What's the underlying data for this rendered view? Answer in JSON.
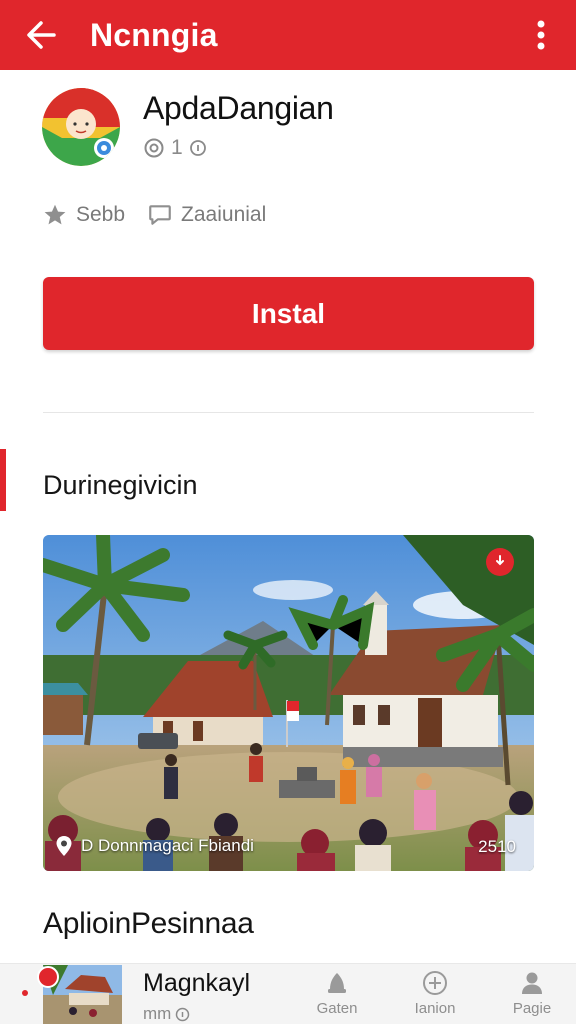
{
  "header": {
    "title": "Ncnngia",
    "back_icon": "arrow-left-icon",
    "menu_icon": "more-vertical-icon",
    "color": "#e0262c"
  },
  "app": {
    "name": "ApdaDangian",
    "meta_icon": "at-sign-icon",
    "meta_value": "1",
    "meta_tail_icon": "info-icon",
    "stats": [
      {
        "icon": "star-icon",
        "label": "Sebb"
      },
      {
        "icon": "comment-icon",
        "label": "Zaaiunial"
      }
    ]
  },
  "install": {
    "label": "Instal"
  },
  "section1": {
    "title": "Durinegivicin"
  },
  "photo": {
    "caption": "D Donnmagaci Fbiandi",
    "counter": "2510",
    "location_icon": "location-pin-icon",
    "badge_icon": "pin-badge-icon"
  },
  "section2": {
    "title": "AplioinPesinnaa"
  },
  "bottom": {
    "mini_title": "Magnkayl",
    "mini_sub": "mm",
    "nav": [
      {
        "icon": "home-icon",
        "label": "Gaten"
      },
      {
        "icon": "add-circle-icon",
        "label": "Ianion"
      },
      {
        "icon": "person-icon",
        "label": "Pagie"
      }
    ]
  }
}
